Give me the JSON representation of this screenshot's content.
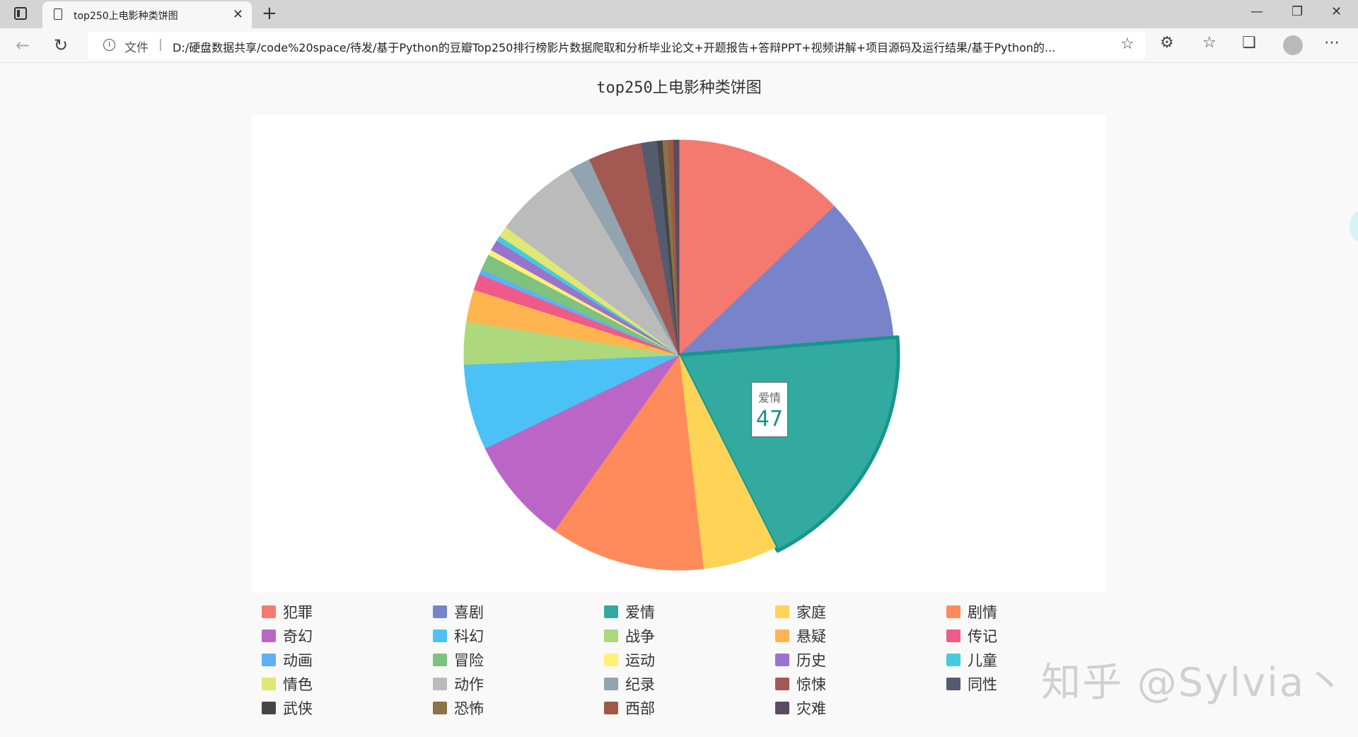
{
  "browser": {
    "tab_title": "top250上电影种类饼图",
    "file_label": "文件",
    "url": "D:/硬盘数据共享/code%20space/待发/基于Python的豆瓣Top250排行榜影片数据爬取和分析毕业论文+开题报告+答辩PPT+视频讲解+项目源码及运行结果/基于Python的..."
  },
  "chart_data": {
    "type": "pie",
    "title": "top250上电影种类饼图",
    "categories": [
      "犯罪",
      "喜剧",
      "爱情",
      "家庭",
      "剧情",
      "奇幻",
      "科幻",
      "战争",
      "悬疑",
      "传记",
      "动画",
      "冒险",
      "运动",
      "历史",
      "儿童",
      "情色",
      "动作",
      "纪录",
      "惊悚",
      "同性",
      "武侠",
      "恐怖",
      "西部",
      "灾难"
    ],
    "values": [
      32,
      27,
      47,
      14,
      29,
      20,
      16,
      8,
      6,
      3,
      1,
      3,
      1,
      2,
      1,
      2,
      16,
      4,
      10,
      3,
      1,
      1,
      1,
      1
    ],
    "colors": [
      "#f47a70",
      "#7784c9",
      "#32aa9f",
      "#ffd355",
      "#ff8b5d",
      "#bb66c7",
      "#4cc1f5",
      "#add87b",
      "#ffb54f",
      "#ef5a88",
      "#5fb0f4",
      "#7dc37f",
      "#fff076",
      "#9a73cd",
      "#48cade",
      "#e0e774",
      "#bbbbbb",
      "#91a4af",
      "#a45852",
      "#545b6f",
      "#454545",
      "#8a7346",
      "#9d5a45",
      "#5c4b60"
    ],
    "highlight": "爱情",
    "legend_position": "bottom"
  },
  "tooltip": {
    "name": "爱情",
    "value": "47"
  },
  "watermark": "知乎 @Sylvia丶"
}
